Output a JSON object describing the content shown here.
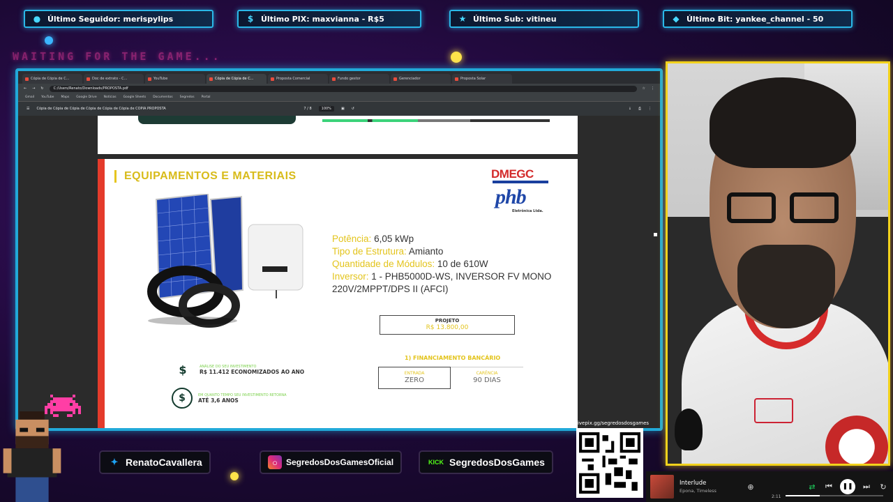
{
  "alerts": [
    {
      "icon": "user-icon",
      "text": "Último Seguidor: merispylips"
    },
    {
      "icon": "dollar-icon",
      "text": "Último PIX: maxvianna - R$5"
    },
    {
      "icon": "star-icon",
      "text": "Último Sub: vitineu"
    },
    {
      "icon": "diamond-icon",
      "text": "Último Bit: yankee_channel - 50"
    }
  ],
  "overlay": {
    "waiting": "WAITING FOR THE GAME..."
  },
  "browser": {
    "tabs": [
      "Cópia de Cópia de C...",
      "Doc de extrato - C...",
      "YouTube",
      "Cópia de Cópia de C...",
      "Proposta Comercial",
      "Fundo gestor",
      "Gerenciador",
      "Proposta Solar"
    ],
    "address": "C:/Users/Renato/Downloads/PROPOSTA.pdf",
    "bookmarks": [
      "Gmail",
      "YouTube",
      "Maps",
      "Google Drive",
      "Notícias",
      "Google Sheets",
      "Documentos",
      "Segredos",
      "Portal"
    ],
    "pdf_title": "Cópia de Cópia de Cópia de Cópia de Cópia de Cópia de COPIA PROPOSTA",
    "page": "7 / 8",
    "zoom": "100%"
  },
  "document": {
    "heading": "EQUIPAMENTOS E MATERIAIS",
    "brand1": "DMEGC",
    "brand2": "phb",
    "brand2_sub": "Eletrônica Ltda.",
    "specs": [
      {
        "label": "Potência:",
        "value": "6,05 kWp"
      },
      {
        "label": "Tipo de Estrutura:",
        "value": "Amianto"
      },
      {
        "label": "Quantidade de Módulos:",
        "value": "10 de 610W"
      },
      {
        "label": "Inversor:",
        "value": "1 - PHB5000D-WS, INVERSOR FV MONO 220V/2MPPT/DPS II (AFCI)"
      }
    ],
    "project_label": "PROJETO",
    "project_value": "R$ 13.800,00",
    "finance_title": "1) FINANCIAMENTO BANCÁRIO",
    "entry_label": "ENTRADA",
    "entry_value": "ZERO",
    "grace_label": "CARÊNCIA",
    "grace_value": "90 DIAS",
    "metric1_label": "ANÁLISE DO SEU INVESTIMENTO",
    "metric1_value": "R$ 11.412 ECONOMIZADOS AO ANO",
    "metric2_label": "EM QUANTO TEMPO SEU INVESTIMENTO RETORNA",
    "metric2_value": "ATÉ 3,6 ANOS"
  },
  "social": {
    "twitter": "RenatoCavallera",
    "instagram": "SegredosDosGamesOficial",
    "kick_tag": "KICK",
    "kick": "SegredosDosGames",
    "qr_label": "livepix.gg/segredosdosgames"
  },
  "player": {
    "song": "Interlude",
    "artist": "Epona, Timeless",
    "time": "2:11",
    "progress": 0.35
  },
  "colors": {
    "accent_blue": "#21a9d9",
    "accent_yellow": "#f2d21c",
    "doc_yellow": "#e3c41c",
    "doc_red": "#e43b2b"
  }
}
